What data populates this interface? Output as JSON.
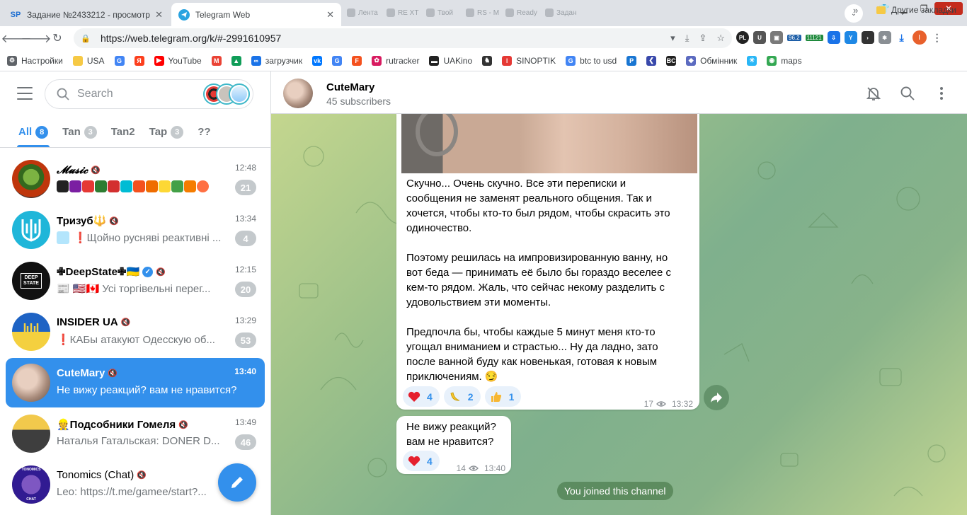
{
  "browser": {
    "tabs": [
      {
        "title": "Задание №2433212 - просмотр з",
        "favicon": "SP"
      },
      {
        "title": "Telegram Web",
        "favicon": "telegram"
      }
    ],
    "mini_tabs": [
      "Лента",
      "RE XT",
      "Твой",
      "RS - M",
      "Ready",
      "Задан"
    ],
    "url": "https://web.telegram.org/k/#-2991610957",
    "extension_badges": {
      "weather": "96.2",
      "counter": "11121"
    },
    "profile_initial": "I",
    "bookmarks": [
      {
        "label": "Настройки",
        "icon": "gear-icon",
        "color": "#5f6368"
      },
      {
        "label": "USA",
        "icon": "folder-icon",
        "color": "#f6c945"
      },
      {
        "label": "",
        "icon": "google-icon",
        "color": "#4285f4"
      },
      {
        "label": "",
        "icon": "yandex-icon",
        "color": "#fc3f1d"
      },
      {
        "label": "YouTube",
        "icon": "youtube-icon",
        "color": "#ff0000"
      },
      {
        "label": "",
        "icon": "gmail-icon",
        "color": "#ea4335"
      },
      {
        "label": "",
        "icon": "drive-icon",
        "color": "#0f9d58"
      },
      {
        "label": "загрузчик",
        "icon": "loop-icon",
        "color": "#1a73e8"
      },
      {
        "label": "",
        "icon": "vk-icon",
        "color": "#0077ff"
      },
      {
        "label": "",
        "icon": "translate-icon",
        "color": "#4285f4"
      },
      {
        "label": "",
        "icon": "f-icon",
        "color": "#f4511e"
      },
      {
        "label": "rutracker",
        "icon": "rutracker-icon",
        "color": "#d81b60"
      },
      {
        "label": "UAKino",
        "icon": "uakino-icon",
        "color": "#222222"
      },
      {
        "label": "",
        "icon": "chess-icon",
        "color": "#333333"
      },
      {
        "label": "SINOPTIK",
        "icon": "thermometer-icon",
        "color": "#e53935"
      },
      {
        "label": "btc to usd",
        "icon": "google-icon",
        "color": "#4285f4"
      },
      {
        "label": "",
        "icon": "p-icon",
        "color": "#1976d2"
      },
      {
        "label": "",
        "icon": "arrow-icon",
        "color": "#3949ab"
      },
      {
        "label": "",
        "icon": "bc-icon",
        "color": "#212121"
      },
      {
        "label": "Обмінник",
        "icon": "diamond-icon",
        "color": "#5c6bc0"
      },
      {
        "label": "",
        "icon": "star-icon",
        "color": "#29b6f6"
      },
      {
        "label": "maps",
        "icon": "maps-icon",
        "color": "#34a853"
      }
    ],
    "bookmarks_more": "»",
    "other_bookmarks": "Другие закладки"
  },
  "sidebar": {
    "search_placeholder": "Search",
    "folders": [
      {
        "label": "All",
        "count": "8",
        "active": true
      },
      {
        "label": "Tan",
        "count": "3",
        "active": false
      },
      {
        "label": "Tan2",
        "count": "",
        "active": false
      },
      {
        "label": "Tap",
        "count": "3",
        "active": false
      },
      {
        "label": "??",
        "count": "",
        "active": false
      }
    ],
    "chats": [
      {
        "name": "𝓜𝓾𝓼𝓲𝓬",
        "time": "12:48",
        "preview": "",
        "badge": "21",
        "verified": false,
        "avatar": "music"
      },
      {
        "name": "Тризуб🔱",
        "time": "13:34",
        "preview": "❗Щойно русняві реактивні ...",
        "badge": "4",
        "verified": false,
        "avatar": "tryzub"
      },
      {
        "name": "✙DeepState✙🇺🇦",
        "time": "12:15",
        "preview": "📰 🇺🇸🇨🇦 Усі торгівельні перег...",
        "badge": "20",
        "verified": true,
        "avatar": "deepstate"
      },
      {
        "name": "INSIDER UA",
        "time": "13:29",
        "preview": "❗КАБы атакуют Одесскую об...",
        "badge": "53",
        "verified": false,
        "avatar": "insider"
      },
      {
        "name": "CuteMary",
        "time": "13:40",
        "preview": "Не вижу реакций? вам не нравится?",
        "badge": "",
        "verified": false,
        "avatar": "cutemary",
        "selected": true
      },
      {
        "name": "👷Подсобники Гомеля",
        "time": "13:49",
        "preview": "Наталья Гатальская: DONER D...",
        "badge": "46",
        "verified": false,
        "avatar": "podsobniki"
      },
      {
        "name": "Tonomics (Chat)",
        "time": "",
        "preview": "Leo: https://t.me/gamee/start?...",
        "badge": "",
        "verified": false,
        "avatar": "tonomics"
      }
    ],
    "deepstate_logo": "DEEP STATE",
    "tonomics_logo_top": "TONOMICS",
    "tonomics_logo_bottom": "CHAT"
  },
  "channel": {
    "title": "CuteMary",
    "subtitle": "45 subscribers"
  },
  "messages": [
    {
      "text": "Скучно... Очень скучно. Все эти переписки и\nсообщения не заменят реального общения. Так и\nхочется, чтобы кто-то был рядом, чтобы скрасить это\nодиночество.\n\nПоэтому решилась на импровизированную ванну, но\nвот беда — принимать её было бы гораздо веселее с\nкем-то рядом. Жаль, что сейчас некому разделить с\nудовольствием эти моменты.\n\nПредпочла бы, чтобы каждые 5 минут меня кто-то\nугощал вниманием и страстью... Ну да ладно, зато\nпосле ванной буду как новенькая, готовая к новым\nприключениям. 😏",
      "reactions": [
        {
          "emoji": "heart-icon",
          "count": "4"
        },
        {
          "emoji": "banana-icon",
          "count": "2"
        },
        {
          "emoji": "thumbs-up-icon",
          "count": "1"
        }
      ],
      "views": "17",
      "time": "13:32"
    },
    {
      "text": "Не вижу реакций?\nвам не нравится?",
      "reactions": [
        {
          "emoji": "heart-icon",
          "count": "4"
        }
      ],
      "views": "14",
      "time": "13:40"
    }
  ],
  "service_message": "You joined this channel",
  "colors": {
    "accent": "#3390ec",
    "badge_muted": "#c4c9cc",
    "reaction_bg": "#e8f1fb"
  }
}
